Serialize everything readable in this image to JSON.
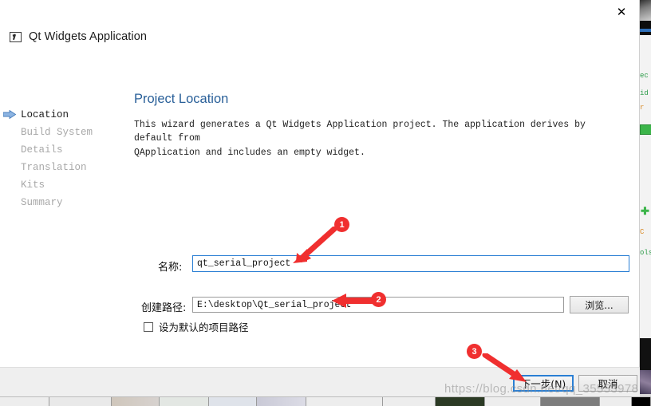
{
  "window": {
    "app_title": "Qt Widgets Application",
    "app_icon": "window-cursor-icon",
    "close_icon": "✕"
  },
  "sidebar": {
    "items": [
      {
        "label": "Location",
        "active": true
      },
      {
        "label": "Build System",
        "active": false
      },
      {
        "label": "Details",
        "active": false
      },
      {
        "label": "Translation",
        "active": false
      },
      {
        "label": "Kits",
        "active": false
      },
      {
        "label": "Summary",
        "active": false
      }
    ]
  },
  "main": {
    "page_title": "Project Location",
    "description": "This wizard generates a Qt Widgets Application project. The application derives by default from\nQApplication and includes an empty widget."
  },
  "form": {
    "name_label": "名称:",
    "name_value": "qt_serial_project",
    "path_label": "创建路径:",
    "path_value": "E:\\desktop\\Qt_serial_project",
    "browse_label": "浏览...",
    "default_path_label": "设为默认的项目路径",
    "default_path_checked": false
  },
  "footer": {
    "next_label": "下一步(N)",
    "cancel_label": "取消"
  },
  "annotations": {
    "badge_1": "1",
    "badge_2": "2",
    "badge_3": "3"
  },
  "watermark": {
    "text": "https://blog.csdn.net/qq_35553978"
  },
  "background_app": {
    "text_1": "ec",
    "text_2": "id",
    "text_3": "r",
    "text_4": "C",
    "text_5": "ols"
  },
  "colors": {
    "accent_blue": "#2a7fd4",
    "title_blue": "#2a6099",
    "annotation_red": "#f02f2f",
    "inactive_gray": "#a8a8a8",
    "footer_gray": "#efefef"
  }
}
